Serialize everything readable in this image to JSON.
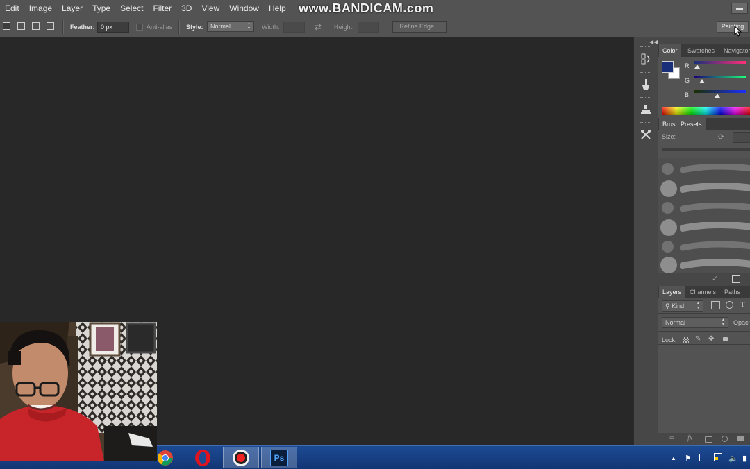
{
  "menu": [
    "Edit",
    "Image",
    "Layer",
    "Type",
    "Select",
    "Filter",
    "3D",
    "View",
    "Window",
    "Help"
  ],
  "watermark": "www.BANDICAM.com",
  "options": {
    "feather_label": "Feather:",
    "feather_value": "0 px",
    "antialias_label": "Anti-alias",
    "style_label": "Style:",
    "style_value": "Normal",
    "width_label": "Width:",
    "height_label": "Height:",
    "refine_edge": "Refine Edge...",
    "workspace": "Painting"
  },
  "color_panel": {
    "tabs": [
      "Color",
      "Swatches",
      "Navigator"
    ],
    "foreground_color": "#1a2f7a",
    "background_color": "#ffffff",
    "channels": [
      {
        "label": "R",
        "level": 0.05,
        "gradient": "linear-gradient(to right,#1a2f7a,#ff2f7a)"
      },
      {
        "label": "G",
        "level": 0.15,
        "gradient": "linear-gradient(to right,#1a007a,#1aff7a)"
      },
      {
        "label": "B",
        "level": 0.45,
        "gradient": "linear-gradient(to right,#1a2f00,#1a2fff)"
      }
    ]
  },
  "brush_presets": {
    "tab": "Brush Presets",
    "size_label": "Size:"
  },
  "layers_panel": {
    "tabs": [
      "Layers",
      "Channels",
      "Paths"
    ],
    "kind_label": "Kind",
    "blend_mode": "Normal",
    "opacity_label": "Opacity:",
    "lock_label": "Lock:"
  },
  "taskbar": {
    "apps": [
      "chrome",
      "opera",
      "bandicam",
      "photoshop"
    ],
    "photoshop_label": "Ps"
  }
}
